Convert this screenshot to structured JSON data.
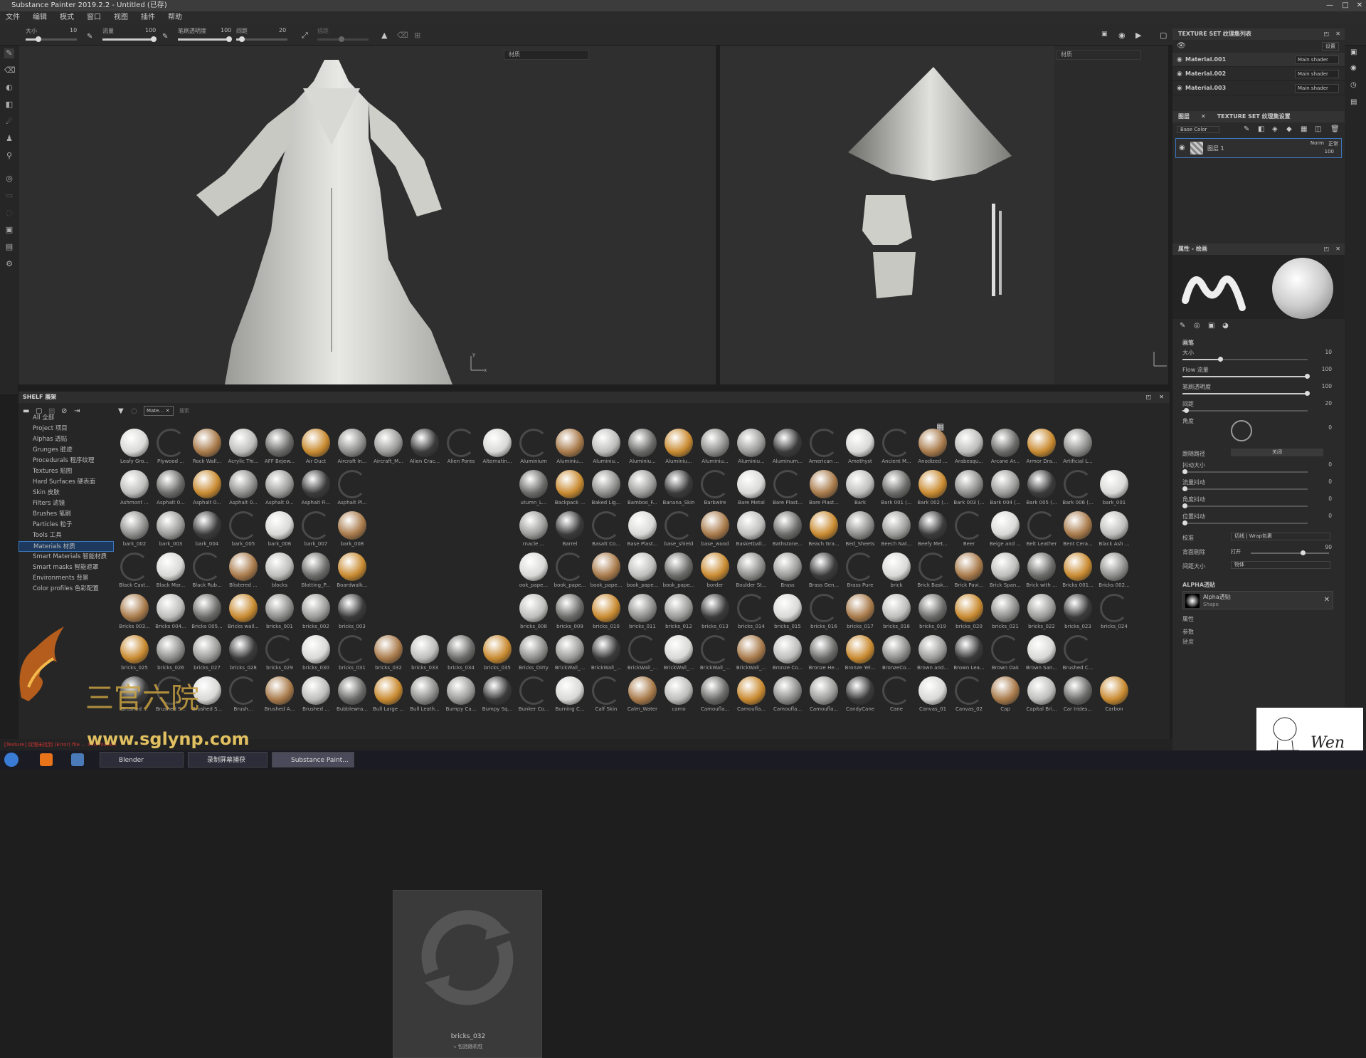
{
  "titlebar": {
    "title": "Substance Painter 2019.2.2 - Untitled (已存)"
  },
  "menu": [
    "文件",
    "编辑",
    "模式",
    "窗口",
    "视图",
    "插件",
    "帮助"
  ],
  "toolopts": {
    "size_label": "大小",
    "size_val": "10",
    "flow_label": "流量",
    "flow_val": "100",
    "opacity_label": "笔刷透明度",
    "opacity_val": "100",
    "spacing_label": "间距",
    "spacing_val": "20",
    "disabled_label": "描距"
  },
  "viewport3d": {
    "dropdown": "材质"
  },
  "viewport2d": {
    "dropdown": "材质"
  },
  "texture_set_list": {
    "title": "TEXTURE SET 纹理集列表",
    "settings": "设置",
    "items": [
      {
        "name": "Material.001",
        "shader": "Main shader"
      },
      {
        "name": "Material.002",
        "shader": "Main shader"
      },
      {
        "name": "Material.003",
        "shader": "Main shader"
      }
    ]
  },
  "layers": {
    "tab_layers": "图层",
    "tab_settings": "TEXTURE SET 纹理集设置",
    "channel": "Base Color",
    "layer_name": "图层 1",
    "blend": "Norm",
    "blend2": "正常",
    "opacity": "100"
  },
  "properties": {
    "title": "属性 - 绘画",
    "section_brush": "画笔",
    "size_label": "大小",
    "size_val": "10",
    "flow_label": "Flow 流量",
    "flow_val": "100",
    "opacity_label": "笔刷透明度",
    "opacity_val": "100",
    "spacing_label": "间距",
    "spacing_val": "20",
    "angle_label": "角度",
    "angle_val": "0",
    "follow_path_label": "跟随路径",
    "follow_path_val": "关闭",
    "jitter_size_label": "抖动大小",
    "jitter_size_val": "0",
    "jitter_flow_label": "流量抖动",
    "jitter_flow_val": "0",
    "jitter_angle_label": "角度抖动",
    "jitter_angle_val": "0",
    "jitter_pos_label": "位置抖动",
    "jitter_pos_val": "0",
    "alignment_label": "校准",
    "alignment_val": "切线 | Wrap包裹",
    "backface_label": "背面剔除",
    "backface_val": "打开",
    "backface_num": "90",
    "size_space_label": "间距大小",
    "size_space_val": "物体",
    "alpha_section": "ALPHA透贴",
    "alpha_name": "Alpha透贴",
    "alpha_sub": "Shape",
    "attr": "属性",
    "params": "参数",
    "hardness": "硬度"
  },
  "shelf": {
    "title": "SHELF 展架",
    "filter_tab": "Mate…",
    "filter_search": "搜索",
    "categories": [
      "All 全部",
      "Project 项目",
      "Alphas 透贴",
      "Grunges 脏迹",
      "Procedurals 程序纹理",
      "Textures 贴图",
      "Hard Surfaces 硬表面",
      "Skin 皮肤",
      "Filters 滤镜",
      "Brushes 笔刷",
      "Particles 粒子",
      "Tools 工具",
      "Materials 材质",
      "Smart Materials 智能材质",
      "Smart masks 智能遮罩",
      "Environments 背景",
      "Color profiles 色彩配置"
    ],
    "selected_category": 12,
    "preview_name": "bricks_032",
    "preview_sub": "⤷ 包括随机性",
    "rows": [
      [
        "Leafy Gro...",
        "Plywood ...",
        "Rock Wall...",
        "Acrylic Thi...",
        "AFF Bejew...",
        "Air Duct",
        "Aircraft In...",
        "Aircraft_M...",
        "Alien Crac...",
        "Alien Pores",
        "Alternatin...",
        "Aluminium",
        "Aluminiu...",
        "Aluminiu...",
        "Aluminiu...",
        "Aluminiu...",
        "Aluminiu...",
        "Aluminiu...",
        "Aluminum...",
        "American ...",
        "Amethyst",
        "Ancient M...",
        "Anodized ...",
        "Arabesqu...",
        "Arcane Ar...",
        "Armor Dra...",
        "Artificial L..."
      ],
      [
        "Ashmont ...",
        "Asphalt 0...",
        "Asphalt 0...",
        "Asphalt 0...",
        "Asphalt 0...",
        "Asphalt Fi...",
        "Asphalt Pl...",
        "",
        "",
        "",
        "",
        "utumn_L...",
        "Backpack ...",
        "Baked Lig...",
        "Bamboo_F...",
        "Banana_Skin",
        "Barbwire",
        "Bare Metal",
        "Bare Plast...",
        "Bare Plast...",
        "Bark",
        "Bark 001 (...",
        "Bark 002 (...",
        "Bark 003 (...",
        "Bark 004 (...",
        "Bark 005 (...",
        "Bark 006 (...",
        "bark_001"
      ],
      [
        "bark_002",
        "bark_003",
        "bark_004",
        "bark_005",
        "bark_006",
        "bark_007",
        "bark_008",
        "",
        "",
        "",
        "",
        "rnacle ...",
        "Barrel",
        "Basalt Co...",
        "Base Plast...",
        "base_shield",
        "base_wood",
        "Basketball...",
        "Bathstone...",
        "Beach Gra...",
        "Bed_Sheets",
        "Beech Nat...",
        "Beefy Met...",
        "Beer",
        "Beige and ...",
        "Belt Leather",
        "Bent Cera...",
        "Black Ash ..."
      ],
      [
        "Black Cast...",
        "Black Mar...",
        "Black Rub...",
        "Blistered ...",
        "blocks",
        "Blotting_P...",
        "Boardwalk...",
        "",
        "",
        "",
        "",
        "ook_pape...",
        "book_pape...",
        "book_pape...",
        "book_pape...",
        "book_pape...",
        "border",
        "Boulder St...",
        "Brass",
        "Brass Gen...",
        "Brass Pure",
        "brick",
        "Brick Bask...",
        "Brick Pavi...",
        "Brick Span...",
        "Brick with ...",
        "Bricks 001...",
        "Bricks 002..."
      ],
      [
        "Bricks 003...",
        "Bricks 004...",
        "Bricks 005...",
        "Bricks wall...",
        "bricks_001",
        "bricks_002",
        "bricks_003",
        "",
        "",
        "",
        "",
        "bricks_008",
        "bricks_009",
        "bricks_010",
        "bricks_011",
        "bricks_012",
        "bricks_013",
        "bricks_014",
        "bricks_015",
        "bricks_016",
        "bricks_017",
        "bricks_018",
        "bricks_019",
        "bricks_020",
        "bricks_021",
        "bricks_022",
        "bricks_023",
        "bricks_024"
      ],
      [
        "bricks_025",
        "bricks_026",
        "bricks_027",
        "bricks_028",
        "bricks_029",
        "bricks_030",
        "bricks_031",
        "bricks_032",
        "bricks_033",
        "bricks_034",
        "bricks_035",
        "Bricks_Dirty",
        "BrickWall_...",
        "BrickWall_...",
        "BrickWall_...",
        "BrickWall_...",
        "BrickWall_...",
        "BrickWall_...",
        "Bronze Co...",
        "Bronze He...",
        "Bronze Yel...",
        "BronzeCo...",
        "Brown and...",
        "Brown Lea...",
        "Brown Oak",
        "Brown San...",
        "Brushed C..."
      ],
      [
        "Brushed ...",
        "Brushed S...",
        "Brushed S...",
        "Brush...",
        "Brushed A...",
        "Brushed ...",
        "Bubblewra...",
        "Bull Large ...",
        "Bull Leath...",
        "Bumpy Ca...",
        "Bumpy Sq...",
        "Bunker Co...",
        "Burning C...",
        "Calf Skin",
        "Calm_Water",
        "camo",
        "Camoufla...",
        "Camoufla...",
        "Camoufla...",
        "Camoufla...",
        "CandyCane",
        "Cane",
        "Canvas_01",
        "Canvas_02",
        "Cap",
        "Capital Bri...",
        "Car Irides...",
        "Carbon"
      ]
    ]
  },
  "status": {
    "text": "[Texture] 纹理未找到 (Error) file ... information"
  },
  "taskbar": {
    "blender": "Blender",
    "recorder": "录制屏幕捕获",
    "painter": "Substance Paint..."
  },
  "watermark": {
    "url": "www.sglynp.com",
    "brand": "三官六院",
    "sig": "Wen"
  }
}
